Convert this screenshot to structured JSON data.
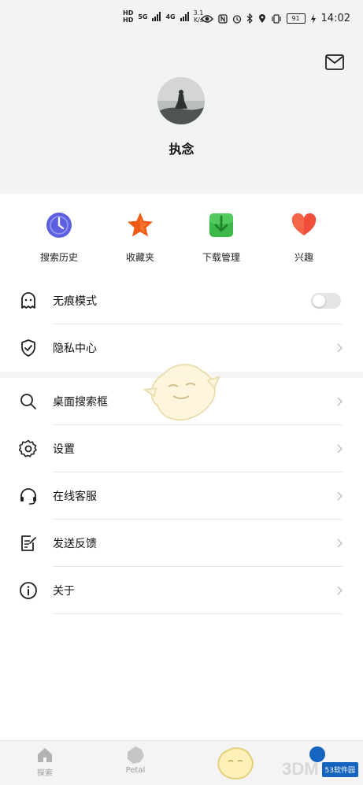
{
  "status_bar": {
    "hd1": "HD",
    "hd2": "HD",
    "net1": "5G",
    "net2": "4G",
    "speed": "3.1",
    "speed_unit": "K/s",
    "battery": "91",
    "time": "14:02",
    "icons": [
      "eye-icon",
      "nfc-icon",
      "alarm-icon",
      "bluetooth-icon",
      "location-icon",
      "vibrate-icon",
      "charging-icon"
    ]
  },
  "header": {
    "mail_icon": "mail-icon",
    "nickname": "执念"
  },
  "shortcuts": [
    {
      "label": "搜索历史",
      "icon": "clock-icon",
      "color": "#5b5fe0"
    },
    {
      "label": "收藏夹",
      "icon": "star-icon",
      "color": "#f05a16"
    },
    {
      "label": "下载管理",
      "icon": "download-icon",
      "color": "#3cb84a"
    },
    {
      "label": "兴趣",
      "icon": "heart-icon",
      "color": "#f04e3c"
    }
  ],
  "menu": {
    "incognito": {
      "label": "无痕模式",
      "icon": "ghost-icon",
      "enabled": false
    },
    "privacy": {
      "label": "隐私中心",
      "icon": "shield-check-icon"
    },
    "desktop_search": {
      "label": "桌面搜索框",
      "icon": "search-icon"
    },
    "settings": {
      "label": "设置",
      "icon": "gear-icon"
    },
    "support": {
      "label": "在线客服",
      "icon": "headset-icon"
    },
    "feedback": {
      "label": "发送反馈",
      "icon": "feedback-icon"
    },
    "about": {
      "label": "关于",
      "icon": "info-icon"
    }
  },
  "bottom_nav": [
    {
      "label": "探索",
      "icon": "home-icon"
    },
    {
      "label": "Petal",
      "icon": "petal-icon"
    }
  ],
  "watermark": {
    "text": "3DM",
    "badge": "53软件园"
  }
}
